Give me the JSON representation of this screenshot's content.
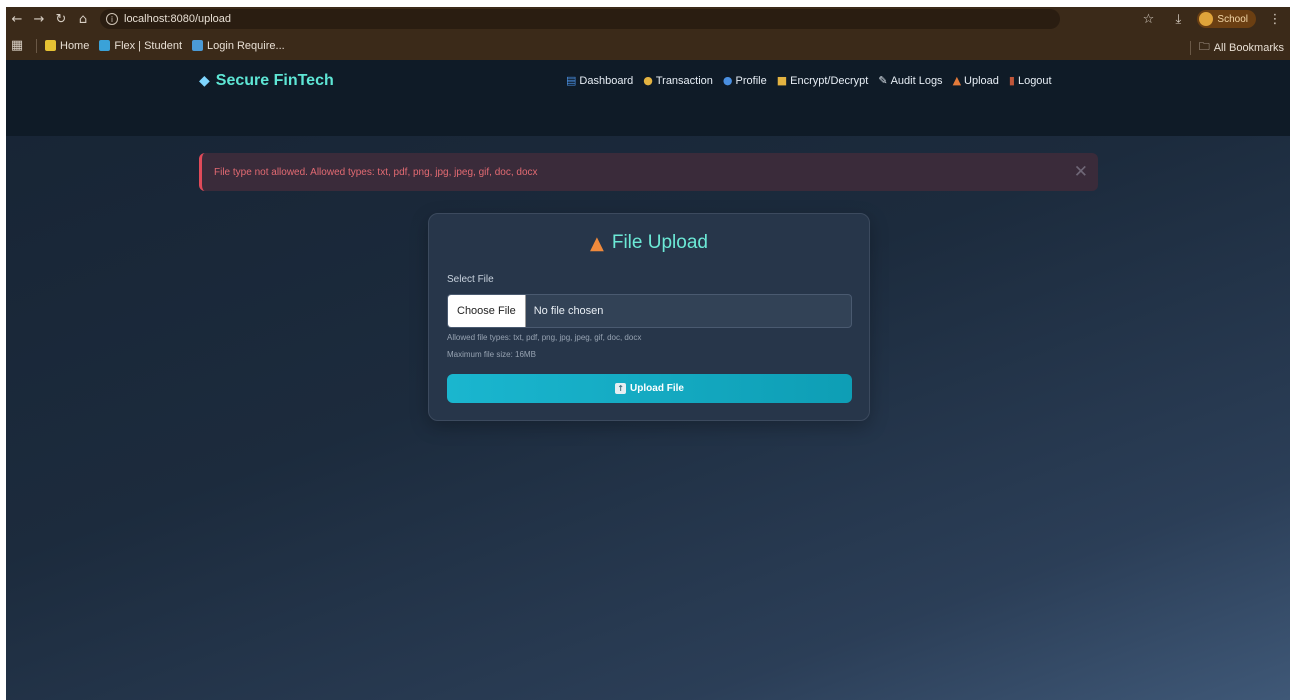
{
  "browser": {
    "url": "localhost:8080/upload",
    "profile_name": "School",
    "bookmarks": [
      {
        "label": "Home",
        "color": "#e6c233"
      },
      {
        "label": "Flex | Student",
        "color": "#3aa2d8"
      },
      {
        "label": "Login Require...",
        "color": "#4b9ad6"
      }
    ],
    "all_bookmarks_label": "All Bookmarks"
  },
  "app": {
    "brand": "Secure FinTech",
    "nav": [
      {
        "label": "Dashboard",
        "icon": "bar-chart-icon"
      },
      {
        "label": "Transaction",
        "icon": "money-bag-icon"
      },
      {
        "label": "Profile",
        "icon": "user-icon"
      },
      {
        "label": "Encrypt/Decrypt",
        "icon": "lock-key-icon"
      },
      {
        "label": "Audit Logs",
        "icon": "memo-icon"
      },
      {
        "label": "Upload",
        "icon": "outbox-icon"
      },
      {
        "label": "Logout",
        "icon": "door-icon"
      }
    ],
    "alert": {
      "message": "File type not allowed. Allowed types: txt, pdf, png, jpg, jpeg, gif, doc, docx",
      "color": "#e04a59"
    },
    "upload_card": {
      "title": "File Upload",
      "select_label": "Select File",
      "choose_button": "Choose File",
      "no_file_text": "No file chosen",
      "allowed_hint": "Allowed file types: txt, pdf, png, jpg, jpeg, gif, doc, docx",
      "max_size_hint": "Maximum file size: 16MB",
      "upload_button": "Upload File"
    },
    "colors": {
      "accent": "#5ee6d5",
      "button": "#1ab6cf"
    }
  }
}
